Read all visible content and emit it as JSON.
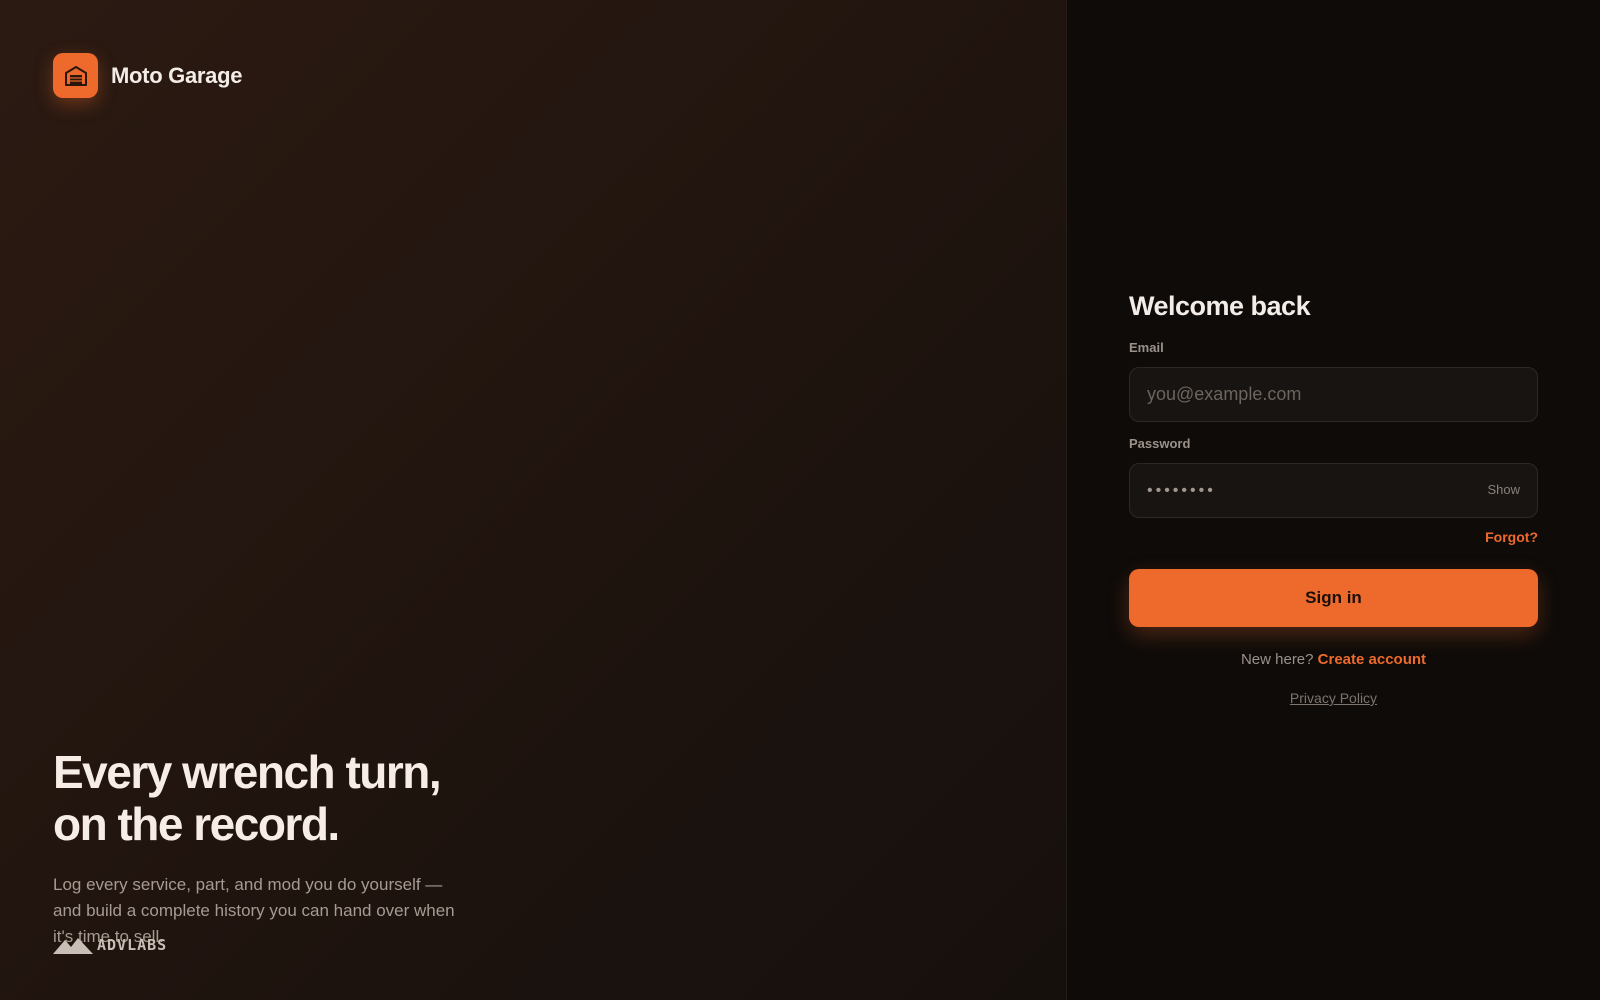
{
  "brand": {
    "name": "Moto Garage",
    "logo_icon": "garage-icon",
    "accent_color": "#ee6a2c"
  },
  "hero": {
    "title_line1": "Every wrench turn,",
    "title_line2": "on the record.",
    "subtitle": "Log every service, part, and mod you do yourself — and build a complete history you can hand over when it's time to sell."
  },
  "footer": {
    "watermark": "ADVLABS",
    "watermark_icon": "mountain-icon"
  },
  "form": {
    "title": "Welcome back",
    "email_label": "Email",
    "email_placeholder": "you@example.com",
    "password_label": "Password",
    "password_masked": "••••••••",
    "show_label": "Show",
    "forgot_label": "Forgot?",
    "signin_label": "Sign in",
    "new_here_text": "New here?",
    "create_account_label": "Create account",
    "privacy_label": "Privacy Policy"
  }
}
